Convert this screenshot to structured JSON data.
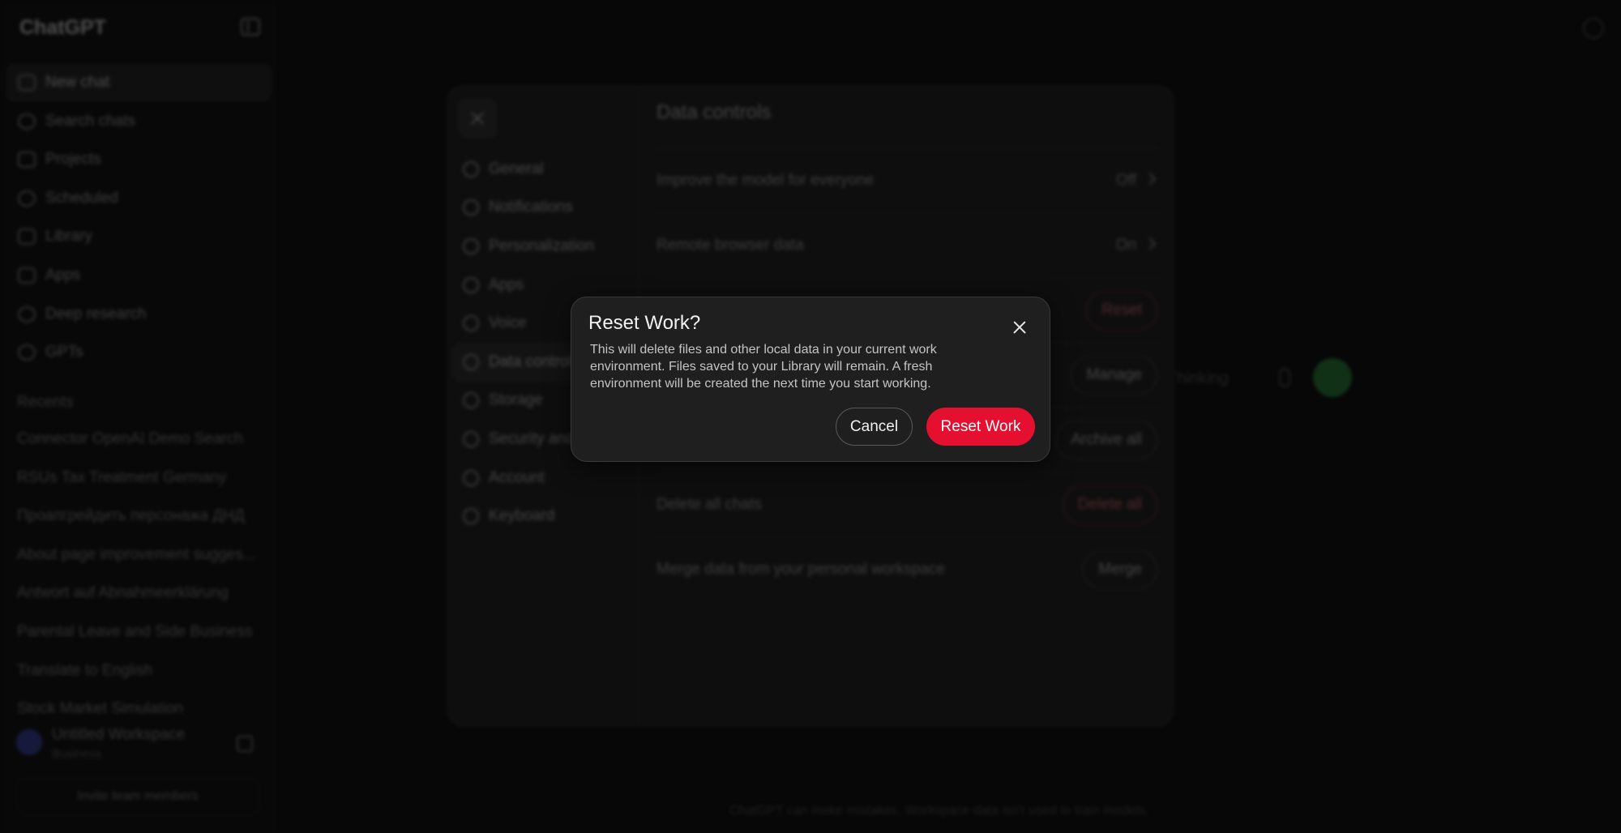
{
  "sidebar": {
    "logo": "ChatGPT",
    "nav": [
      {
        "label": "New chat",
        "icon": "edit-icon"
      },
      {
        "label": "Search chats",
        "icon": "search-icon"
      },
      {
        "label": "Projects",
        "icon": "folder-icon"
      },
      {
        "label": "Scheduled",
        "icon": "clock-icon"
      },
      {
        "label": "Library",
        "icon": "library-icon"
      },
      {
        "label": "Apps",
        "icon": "apps-icon"
      },
      {
        "label": "Deep research",
        "icon": "telescope-icon"
      },
      {
        "label": "GPTs",
        "icon": "cube-icon"
      }
    ],
    "recents_heading": "Recents",
    "recents": [
      "Connector OpenAI Demo Search",
      "RSUs Tax Treatment Germany",
      "Проапгрейдить персонажа ДНД",
      "About page improvement sugges...",
      "Antwort auf Abnahmeerklärung",
      "Parental Leave and Side Business",
      "Translate to English",
      "Stock Market Simulation"
    ],
    "workspace": {
      "name": "Untitled Workspace",
      "plan": "Business"
    },
    "invite_label": "Invite team members"
  },
  "composer": {
    "mode_label": "Thinking"
  },
  "footer_note": "ChatGPT can make mistakes. Workspace data isn't used to train models.",
  "settings": {
    "title": "Data controls",
    "nav": [
      {
        "label": "General",
        "icon": "gear-icon"
      },
      {
        "label": "Notifications",
        "icon": "bell-icon"
      },
      {
        "label": "Personalization",
        "icon": "personalization-icon"
      },
      {
        "label": "Apps",
        "icon": "apps-icon"
      },
      {
        "label": "Voice",
        "icon": "waveform-icon"
      },
      {
        "label": "Data controls",
        "icon": "database-icon"
      },
      {
        "label": "Storage",
        "icon": "storage-icon"
      },
      {
        "label": "Security and",
        "icon": "shield-icon"
      },
      {
        "label": "Account",
        "icon": "account-icon"
      },
      {
        "label": "Keyboard",
        "icon": "keyboard-icon"
      }
    ],
    "rows": {
      "improve": {
        "label": "Improve the model for everyone",
        "value": "Off"
      },
      "remote": {
        "label": "Remote browser data",
        "value": "On"
      },
      "reset_btn": "Reset",
      "manage_btn": "Manage",
      "archive_btn": "Archive all",
      "delete": {
        "label": "Delete all chats",
        "button": "Delete all"
      },
      "merge": {
        "label": "Merge data from your personal workspace",
        "button": "Merge"
      }
    }
  },
  "dialog": {
    "title": "Reset Work?",
    "body": "This will delete files and other local data in your current work environment. Files saved to your Library will remain. A fresh environment will be created the next time you start working.",
    "cancel_label": "Cancel",
    "confirm_label": "Reset Work",
    "confirm_color": "#e5102f"
  }
}
